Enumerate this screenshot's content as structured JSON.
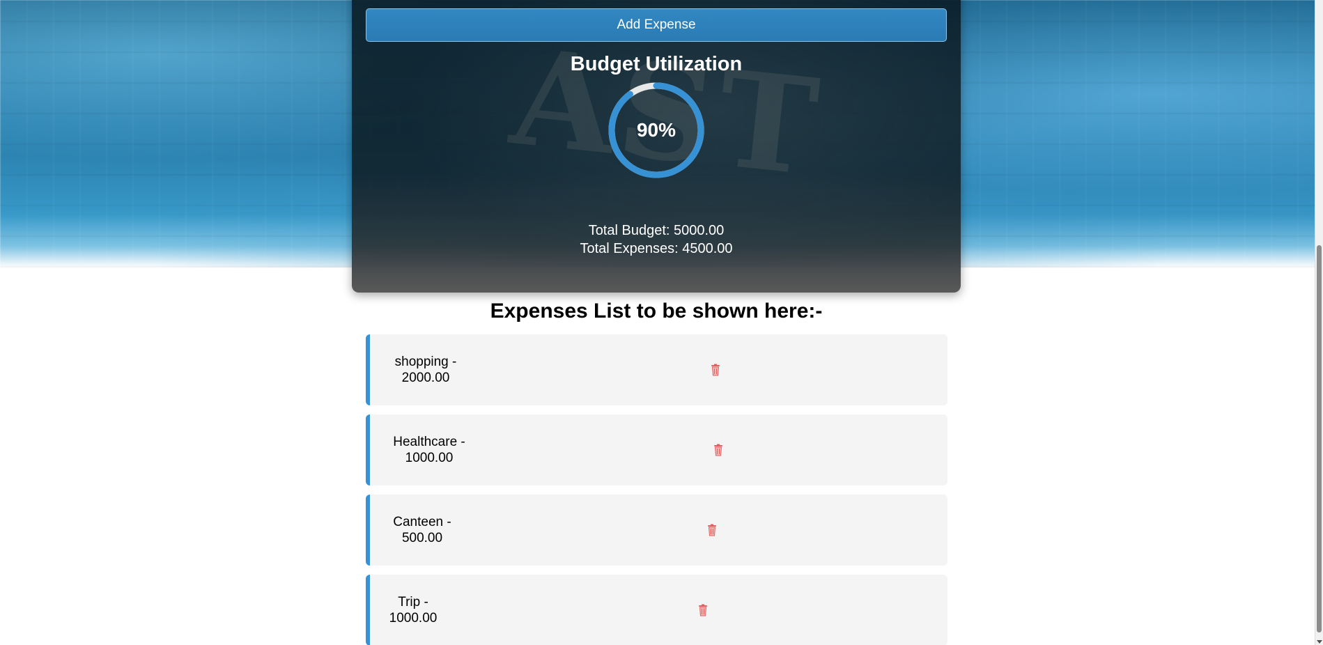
{
  "panel": {
    "add_button_label": "Add Expense",
    "budget_title": "Budget Utilization",
    "utilization_percent_label": "90%",
    "utilization_fraction": 0.9,
    "total_budget_label": "Total Budget: 5000.00",
    "total_expenses_label": "Total Expenses: 4500.00"
  },
  "expenses": {
    "title": "Expenses List to be shown here:-",
    "items": [
      {
        "name": "shopping -",
        "amount": "2000.00",
        "delete_icon": "trash-icon"
      },
      {
        "name": "Healthcare -",
        "amount": "1000.00",
        "delete_icon": "trash-icon"
      },
      {
        "name": "Canteen -",
        "amount": "500.00",
        "delete_icon": "trash-icon"
      },
      {
        "name": "Trip -",
        "amount": "1000.00",
        "delete_icon": "trash-icon"
      }
    ]
  },
  "colors": {
    "accent": "#3692d5",
    "button": "#2a7bb4",
    "ring_track": "#e8e8e8",
    "delete": "#e06060"
  }
}
